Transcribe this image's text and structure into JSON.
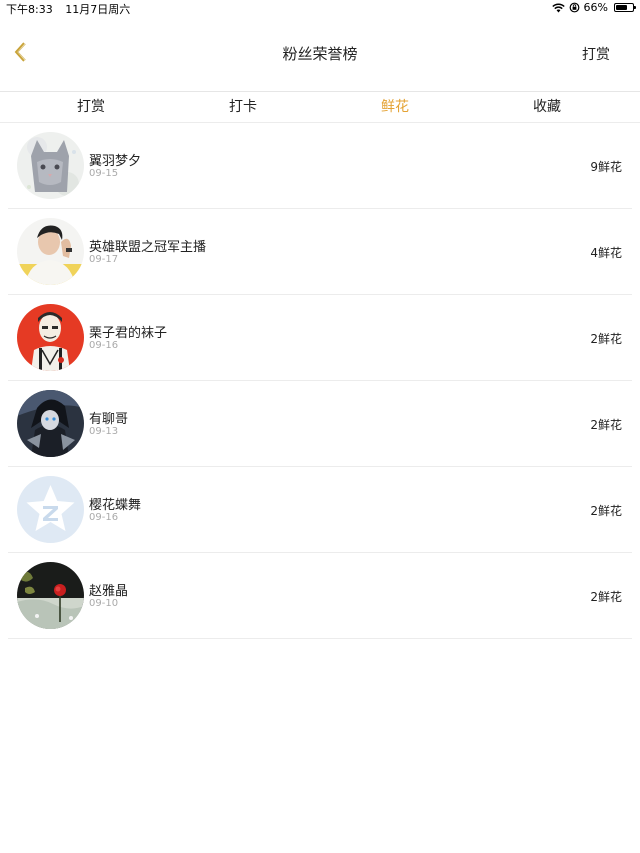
{
  "status_bar": {
    "time": "下午8:33",
    "date": "11月7日周六",
    "battery": "66%",
    "battery_level": 0.66,
    "icons": [
      "wifi-icon",
      "orientation-lock-icon",
      "battery-icon"
    ]
  },
  "header": {
    "title": "粉丝荣誉榜",
    "right_action": "打赏",
    "back_icon": "chevron-left-icon",
    "accent_color": "#e4a233"
  },
  "tabs": [
    {
      "label": "打赏",
      "active": false
    },
    {
      "label": "打卡",
      "active": false
    },
    {
      "label": "鲜花",
      "active": true
    },
    {
      "label": "收藏",
      "active": false
    }
  ],
  "list": [
    {
      "name": "翼羽梦夕",
      "date": "09-15",
      "count": "9鲜花",
      "avatar": "cat-avatar"
    },
    {
      "name": "英雄联盟之冠军主播",
      "date": "09-17",
      "count": "4鲜花",
      "avatar": "man-avatar"
    },
    {
      "name": "栗子君的袜子",
      "date": "09-16",
      "count": "2鲜花",
      "avatar": "illustration-avatar"
    },
    {
      "name": "有聊哥",
      "date": "09-13",
      "count": "2鲜花",
      "avatar": "anime-avatar"
    },
    {
      "name": "樱花蝶舞",
      "date": "09-16",
      "count": "2鲜花",
      "avatar": "qq-default-avatar"
    },
    {
      "name": "赵雅晶",
      "date": "09-10",
      "count": "2鲜花",
      "avatar": "rose-avatar"
    }
  ]
}
